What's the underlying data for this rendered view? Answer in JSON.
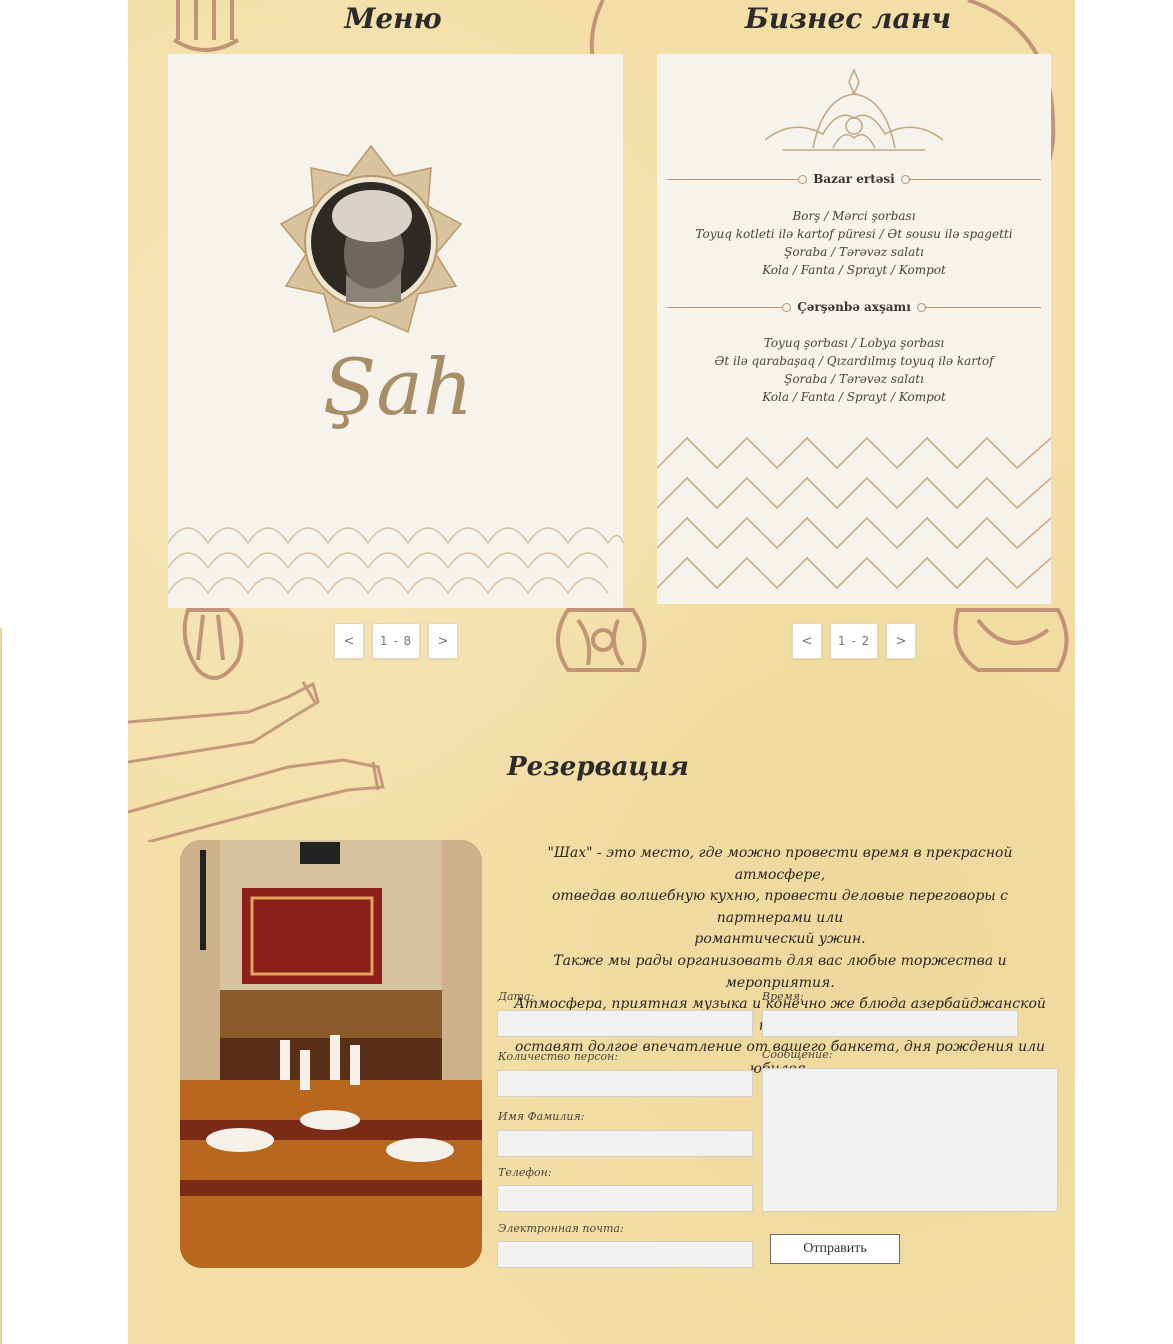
{
  "menu": {
    "title": "Меню",
    "logo_text": "Şah",
    "pager": {
      "prev": "<",
      "pages": "1 - 8",
      "next": ">"
    }
  },
  "lunch": {
    "title": "Бизнес ланч",
    "days": [
      {
        "name": "Bazar ertəsi",
        "items": [
          "Borş / Mərci şorbası",
          "Toyuq kotleti ilə kartof püresi  /  Ət sousu ilə spagetti",
          "Şoraba / Tərəvəz salatı",
          "Kola / Fanta / Sprayt / Kompot"
        ]
      },
      {
        "name": "Çərşənbə axşamı",
        "items": [
          "Toyuq şorbası / Lobya şorbası",
          "Ət ilə qarabaşaq / Qızardılmış toyuq ilə kartof",
          "Şoraba / Tərəvəz salatı",
          "Kola / Fanta / Sprayt / Kompot"
        ]
      }
    ],
    "pager": {
      "prev": "<",
      "pages": "1 - 2",
      "next": ">"
    }
  },
  "reservation": {
    "title": "Резервация",
    "description": [
      "\"Шах\" - это место, где можно провести время в прекрасной атмосфере,",
      "отведав волшебную кухню, провести деловые переговоры с партнерами или",
      "романтический ужин.",
      "Также мы рады организовать для вас любые торжества и мероприятия.",
      "Атмосфера, приятная музыка и конечно же блюда азербайджанской кухни",
      "оставят долгое впечатление от вашего банкета, дня рождения или юбилея."
    ],
    "form": {
      "date_label": "Дата:",
      "time_label": "Время:",
      "persons_label": "Количество персон:",
      "message_label": "Сообщение:",
      "name_label": "Имя Фамилия:",
      "phone_label": "Телефон:",
      "email_label": "Электронная почта:",
      "submit": "Отправить"
    }
  },
  "colors": {
    "background": "#f3dfa6",
    "card": "#f6f3ec",
    "ornament": "#c7ab86",
    "sketch": "#b9876f",
    "title": "#2d2a2e"
  }
}
